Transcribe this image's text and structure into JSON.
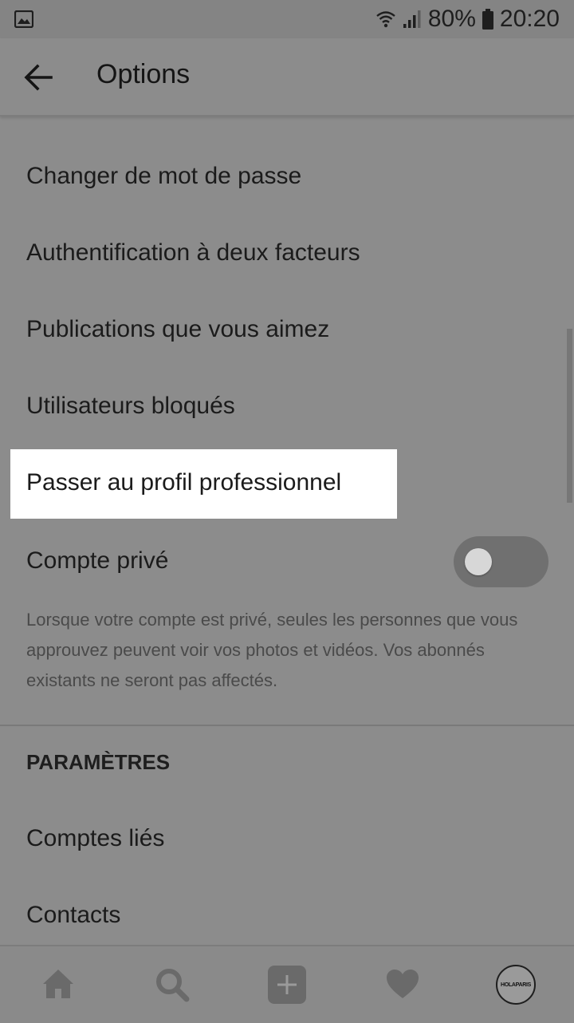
{
  "status_bar": {
    "battery": "80%",
    "time": "20:20"
  },
  "app_bar": {
    "title": "Options"
  },
  "menu": {
    "items": [
      {
        "label": "Changer de mot de passe"
      },
      {
        "label": "Authentification à deux facteurs"
      },
      {
        "label": "Publications que vous aimez"
      },
      {
        "label": "Utilisateurs bloqués"
      },
      {
        "label": "Passer au profil professionnel"
      }
    ],
    "private_account": {
      "label": "Compte privé",
      "enabled": false,
      "description": "Lorsque votre compte est privé, seules les personnes que vous approuvez peuvent voir vos photos et vidéos. Vos abonnés existants ne seront pas affectés."
    }
  },
  "settings_section": {
    "header": "PARAMÈTRES",
    "items": [
      {
        "label": "Comptes liés"
      },
      {
        "label": "Contacts"
      }
    ]
  },
  "bottom_nav": {
    "items": [
      "home-icon",
      "search-icon",
      "add-post-icon",
      "heart-icon",
      "profile-avatar"
    ],
    "avatar_text": "HOLAPARIS"
  },
  "colors": {
    "overlay_gray": "#8c8c8c",
    "highlight": "#ffffff",
    "text": "#1b1b1b"
  }
}
